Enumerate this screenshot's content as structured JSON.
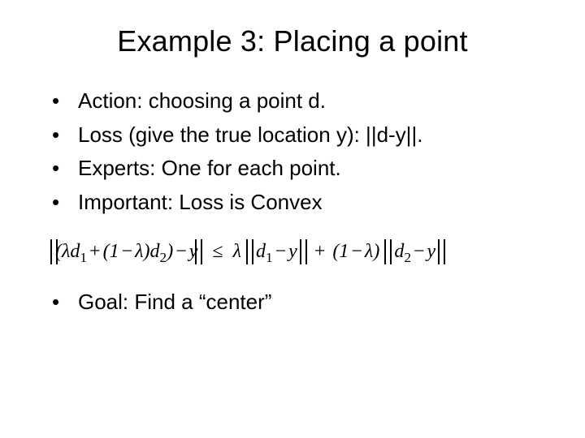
{
  "title": "Example 3: Placing a point",
  "bullets": [
    "Action: choosing a point d.",
    "Loss (give the true location y): ||d-y||.",
    "Experts: One for each point.",
    "Important: Loss is Convex"
  ],
  "formula": {
    "lhs_inner": "(λd₁+(1−λ)d₂)−y",
    "le": "≤",
    "r1_coef": "λ",
    "r1_inner": "d₁−y",
    "plus": "+",
    "r2_coef": "(1−λ)",
    "r2_inner": "d₂−y"
  },
  "goal": "Goal: Find a “center”"
}
